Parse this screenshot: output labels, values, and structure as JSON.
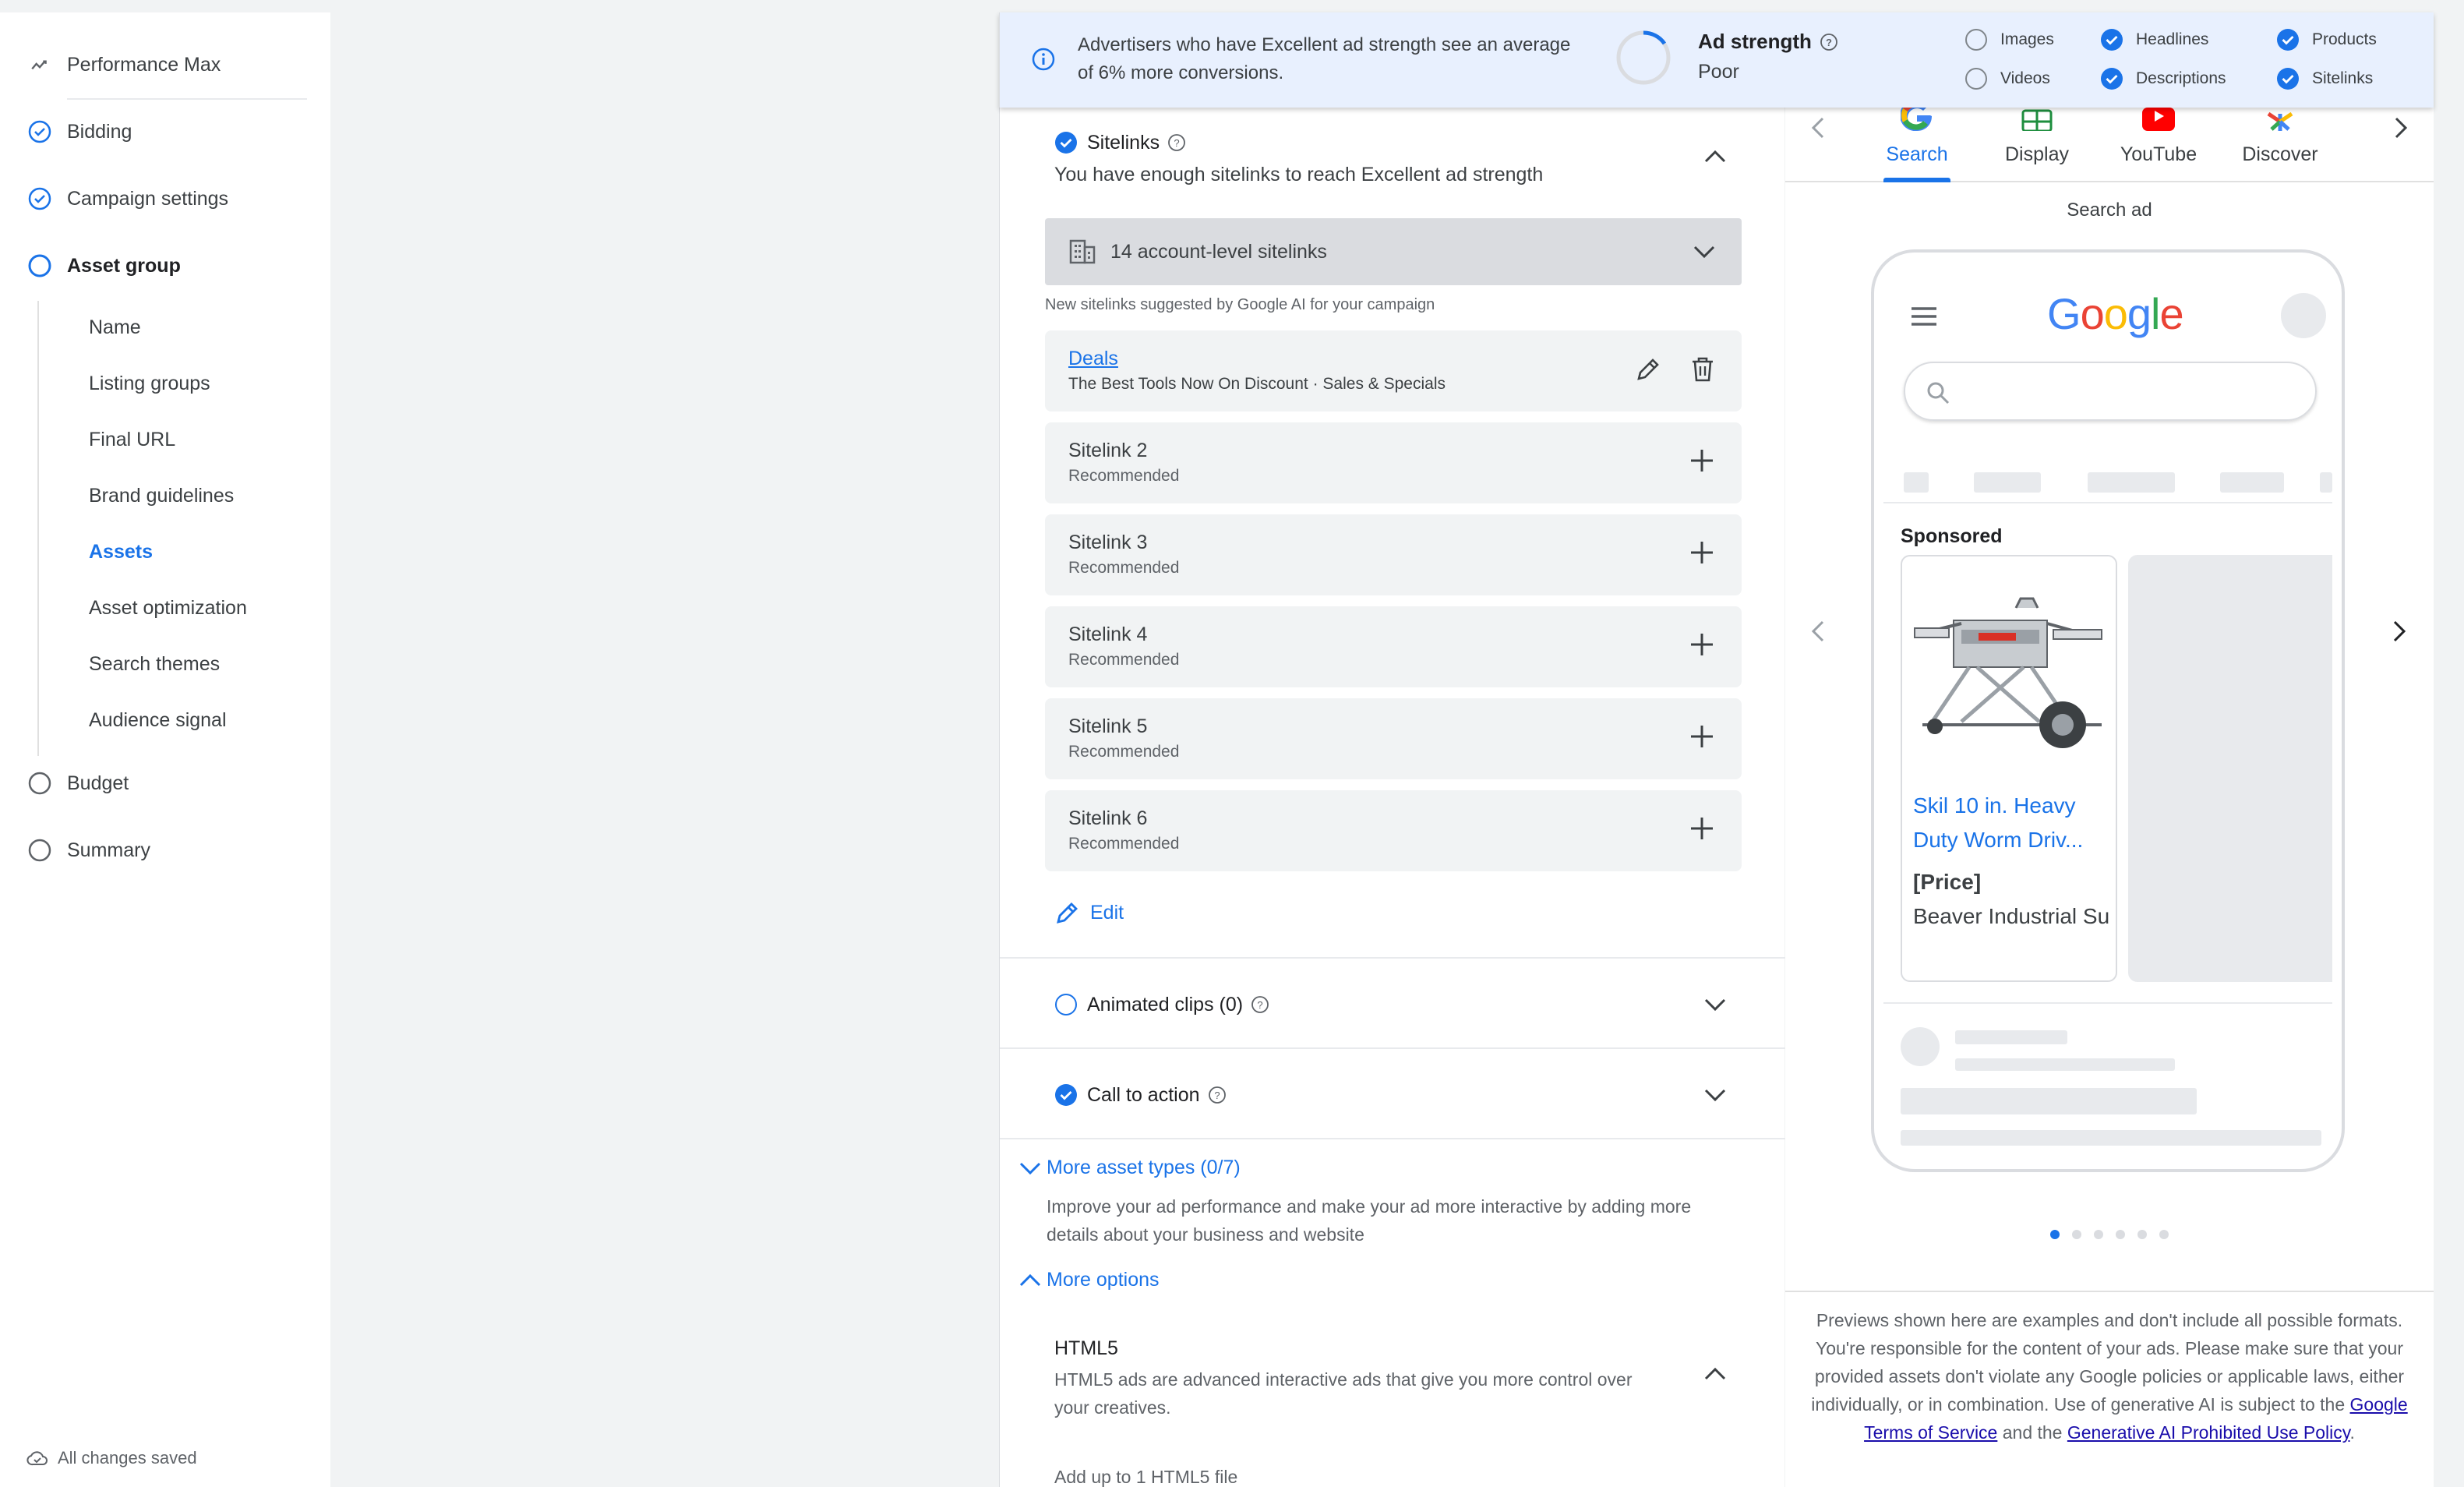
{
  "sidebar": {
    "title": "Performance Max",
    "steps": [
      {
        "label": "Bidding",
        "state": "done"
      },
      {
        "label": "Campaign settings",
        "state": "done"
      },
      {
        "label": "Asset group",
        "state": "current"
      },
      {
        "label": "Budget",
        "state": "todo"
      },
      {
        "label": "Summary",
        "state": "todo"
      }
    ],
    "sub_items": [
      "Name",
      "Listing groups",
      "Final URL",
      "Brand guidelines",
      "Assets",
      "Asset optimization",
      "Search themes",
      "Audience signal"
    ],
    "active_sub_item": "Assets",
    "saved_status": "All changes saved"
  },
  "banner": {
    "message": "Advertisers who have Excellent ad strength see an average of 6% more conversions.",
    "ad_strength_label": "Ad strength",
    "ad_strength_value": "Poor",
    "checklist": [
      {
        "label": "Images",
        "checked": false
      },
      {
        "label": "Headlines",
        "checked": true
      },
      {
        "label": "Products",
        "checked": true
      },
      {
        "label": "Videos",
        "checked": false
      },
      {
        "label": "Descriptions",
        "checked": true
      },
      {
        "label": "Sitelinks",
        "checked": true
      }
    ]
  },
  "sitelinks": {
    "title": "Sitelinks",
    "subtitle": "You have enough sitelinks to reach Excellent ad strength",
    "account_level": "14 account-level sitelinks",
    "suggest_note": "New sitelinks suggested by Google AI for your campaign",
    "items": [
      {
        "title": "Deals",
        "desc": "The Best Tools Now On Discount · Sales & Specials"
      },
      {
        "title": "Sitelink 2",
        "desc": "Recommended"
      },
      {
        "title": "Sitelink 3",
        "desc": "Recommended"
      },
      {
        "title": "Sitelink 4",
        "desc": "Recommended"
      },
      {
        "title": "Sitelink 5",
        "desc": "Recommended"
      },
      {
        "title": "Sitelink 6",
        "desc": "Recommended"
      }
    ],
    "edit_label": "Edit"
  },
  "animated_clips": {
    "title": "Animated clips (0)"
  },
  "call_to_action": {
    "title": "Call to action"
  },
  "more_asset_types": {
    "label": "More asset types (0/7)",
    "description": "Improve your ad performance and make your ad more interactive by adding more details about your business and website"
  },
  "more_options": {
    "label": "More options"
  },
  "html5": {
    "title": "HTML5",
    "description": "HTML5 ads are advanced interactive ads that give you more control over your creatives.",
    "add_note": "Add up to 1 HTML5 file"
  },
  "preview": {
    "tabs": [
      {
        "label": "Search",
        "icon": "google-g-icon"
      },
      {
        "label": "Display",
        "icon": "display-icon"
      },
      {
        "label": "YouTube",
        "icon": "youtube-icon"
      },
      {
        "label": "Discover",
        "icon": "discover-icon"
      }
    ],
    "active_tab": "Search",
    "title": "Search ad",
    "logo_text": "Google",
    "sponsored": "Sponsored",
    "product": {
      "name": "Skil 10 in. Heavy Duty Worm Driv...",
      "price": "[Price]",
      "seller": "Beaver Industrial Su"
    },
    "dots_total": 6,
    "dots_active": 1,
    "disclaimer_text": "Previews shown here are examples and don't include all possible formats. You're responsible for the content of your ads. Please make sure that your provided assets don't violate any Google policies or applicable laws, either individually, or in combination. Use of generative AI is subject to the",
    "terms_link": "Google Terms of Service",
    "and_text": "and the",
    "policy_link": "Generative AI Prohibited Use Policy",
    "end_text": "."
  },
  "colors": {
    "accent": "#1a73e8",
    "banner_bg": "#e8f0fe",
    "card_bg": "#f1f3f4",
    "link": "#1a0dab"
  }
}
